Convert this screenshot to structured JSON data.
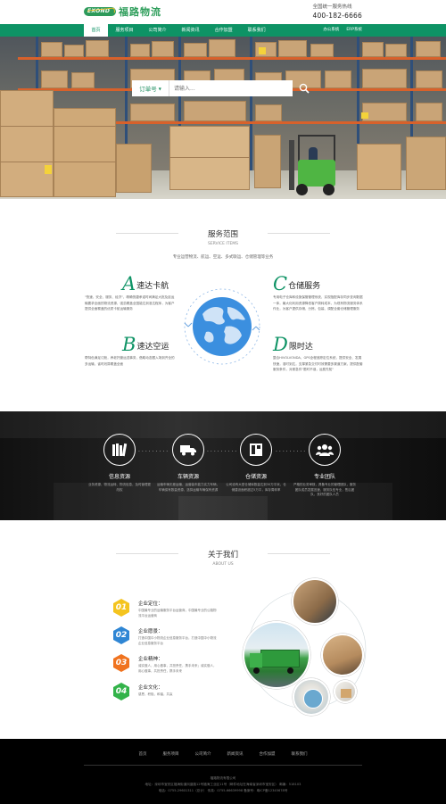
{
  "header": {
    "logo_en": "EXOND",
    "logo_cn": "福路物流",
    "hotline_label": "全国统一服务热线",
    "hotline_number": "400-182-6666"
  },
  "nav": {
    "items": [
      "首页",
      "服务项目",
      "公司简介",
      "新闻资讯",
      "合作加盟",
      "联系我们"
    ],
    "right": [
      "办公系统",
      "ERP系统"
    ]
  },
  "search": {
    "label": "订单号",
    "placeholder": "请输入..."
  },
  "services": {
    "title": "服务范围",
    "subtitle_en": "SERVICE ITEMS",
    "intro": "专业运营物流、航运、空运、多式联运、仓储管理等业务",
    "items": [
      {
        "letter": "A",
        "name": "速达卡航",
        "desc": "\"快速、安全、服务、经济\"，精确快捷承诺时间满足大批及延运输要求全面的物流资源，强劲覆盖全国能达到准达程序，为客户提供全面覆盖的优质卡航运输服务"
      },
      {
        "letter": "B",
        "name": "速达空运",
        "desc": "帮特色满足订舱，养老托管运送事务，借助动态跟入场到齐全的多运输，省时划算覆盖全面"
      },
      {
        "letter": "C",
        "name": "仓储服务",
        "desc": "专用电子仓库和设施保管管理系统，实现指配库存同步查询数据一体，最大化利用资源降低客户周转成本，为现有物流服务体系作业，为客户提供存储、分拣、包装、调配全套仓储管理服务"
      },
      {
        "letter": "D",
        "name": "限时达",
        "desc": "整合HIVOLVONDA，GPS全程追踪定位系统，提供安全、发展快速，准时到达，支撑紧急交付时效需要多渠道方案，提供配套服务条件，对紧急件\"限时不误，运费先知\""
      }
    ]
  },
  "features": [
    {
      "icon": "books-icon",
      "title": "信息资源",
      "desc": "业务资源、物流运转、物流信息，及时营理更改权"
    },
    {
      "icon": "truck-icon",
      "title": "车辆资源",
      "desc": "运输车辆无差运输，运营装车能力实力车辆，车辆保有数量资源，选择运输车辆保有资源"
    },
    {
      "icon": "warehouse-icon",
      "title": "仓储资源",
      "desc": "公司设有大型仓储库数量达到30万平米，仓储建设面积超过5万平，库存周转率"
    },
    {
      "icon": "team-icon",
      "title": "专业团队",
      "desc": "严格的业务审核，具备专业的管理团队，服务团队成员发展迅速，服务队伍专业，售后团队，良好的团队人员"
    }
  ],
  "about": {
    "title": "关于我们",
    "subtitle_en": "ABOUT US",
    "items": [
      {
        "num": "01",
        "title": "企业定位：",
        "desc": "中国最专业的运输服务平台运营商，中国最专业的公路物流平台运营商"
      },
      {
        "num": "02",
        "title": "企业愿景：",
        "desc": "打造中国中小物流企业信息服务平台，打造中国中小物流企业信息服务平台"
      },
      {
        "num": "03",
        "title": "企业精神：",
        "desc": "诚实做人，用心做事，共担责任，携手未来；诚实做人，用心做事，共担责任，携手未来"
      },
      {
        "num": "04",
        "title": "企业文化：",
        "desc": "感恩，积极，和谐，共赢"
      }
    ]
  },
  "footer": {
    "nav": [
      "首页",
      "服务项目",
      "公司简介",
      "新闻资讯",
      "合作加盟",
      "联系我们"
    ],
    "company": "福路物流有限公司",
    "address": "地址：深圳市宝安区福海街道凤凰路12号福海工业区11号（邮件地址在海南省深圳市宝安区）  邮编：518103",
    "contact": "电话：0755-29601311（总计）  传真：0755-66639998  备案号：粤ICP备12345678号"
  },
  "colors": {
    "brand_green": "#0e9365",
    "hex_yellow": "#f4c41f",
    "hex_blue": "#2f86d4",
    "hex_orange": "#f0731f",
    "hex_green": "#33b34a"
  }
}
